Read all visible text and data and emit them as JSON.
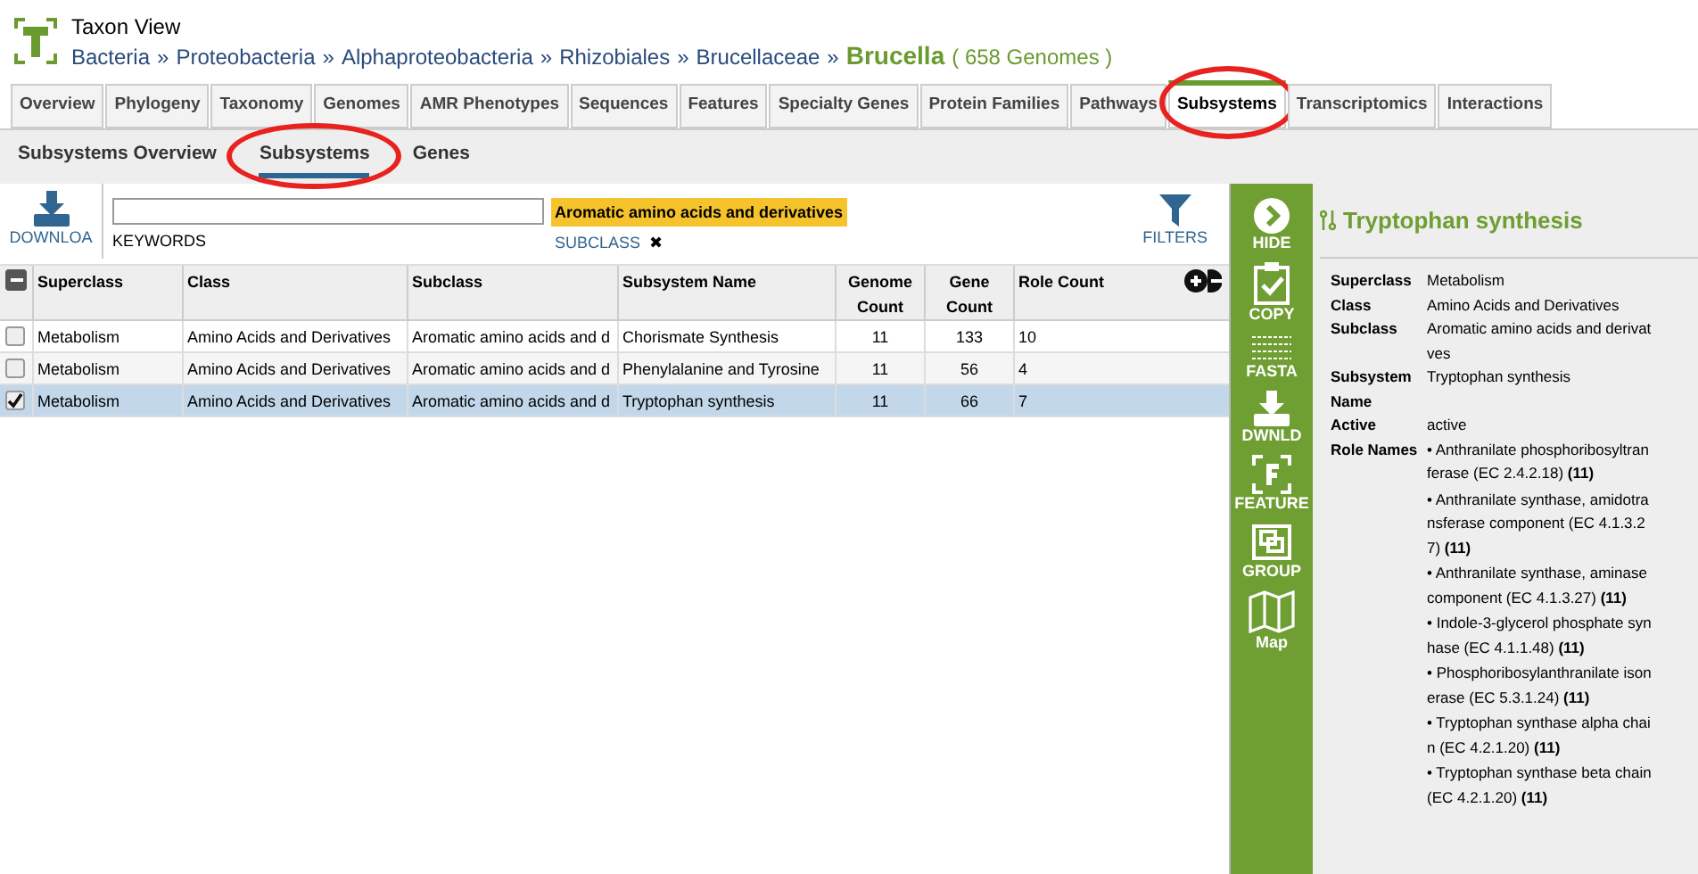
{
  "header": {
    "title": "Taxon View",
    "separator": "»",
    "breadcrumb": [
      "Bacteria",
      "Proteobacteria",
      "Alphaproteobacteria",
      "Rhizobiales",
      "Brucellaceae"
    ],
    "taxon": "Brucella",
    "genome_count": "( 658 Genomes )"
  },
  "tabs": [
    {
      "label": "Overview",
      "selected": false,
      "circled": false
    },
    {
      "label": "Phylogeny",
      "selected": false,
      "circled": false
    },
    {
      "label": "Taxonomy",
      "selected": false,
      "circled": false
    },
    {
      "label": "Genomes",
      "selected": false,
      "circled": false
    },
    {
      "label": "AMR Phenotypes",
      "selected": false,
      "circled": false
    },
    {
      "label": "Sequences",
      "selected": false,
      "circled": false
    },
    {
      "label": "Features",
      "selected": false,
      "circled": false
    },
    {
      "label": "Specialty Genes",
      "selected": false,
      "circled": false
    },
    {
      "label": "Protein Families",
      "selected": false,
      "circled": false
    },
    {
      "label": "Pathways",
      "selected": false,
      "circled": false
    },
    {
      "label": "Subsystems",
      "selected": true,
      "circled": true
    },
    {
      "label": "Transcriptomics",
      "selected": false,
      "circled": false
    },
    {
      "label": "Interactions",
      "selected": false,
      "circled": false
    }
  ],
  "subtabs": [
    {
      "label": "Subsystems Overview",
      "selected": false,
      "circled": false
    },
    {
      "label": "Subsystems",
      "selected": true,
      "circled": true
    },
    {
      "label": "Genes",
      "selected": false,
      "circled": false
    }
  ],
  "toolbar": {
    "download": "DOWNLOA",
    "keywords_label": "KEYWORDS",
    "filter_value": "Aromatic amino acids and derivatives",
    "filter_label": "SUBCLASS",
    "filter_remove": "✖",
    "filters": "FILTERS"
  },
  "table": {
    "select_all_partial": true,
    "columns": [
      "Superclass",
      "Class",
      "Subclass",
      "Subsystem Name",
      "Genome Count",
      "Gene Count",
      "Role Count"
    ],
    "rows": [
      {
        "selected": false,
        "cells": [
          "Metabolism",
          "Amino Acids and Derivatives",
          "Aromatic amino acids and d",
          "Chorismate Synthesis",
          "11",
          "133",
          "10"
        ]
      },
      {
        "selected": false,
        "cells": [
          "Metabolism",
          "Amino Acids and Derivatives",
          "Aromatic amino acids and d",
          "Phenylalanine and Tyrosine",
          "11",
          "56",
          "4"
        ]
      },
      {
        "selected": true,
        "cells": [
          "Metabolism",
          "Amino Acids and Derivatives",
          "Aromatic amino acids and d",
          "Tryptophan synthesis",
          "11",
          "66",
          "7"
        ]
      }
    ]
  },
  "actions": [
    {
      "kind": "hide",
      "label": "HIDE"
    },
    {
      "kind": "copy",
      "label": "COPY"
    },
    {
      "kind": "fasta",
      "label": "FASTA"
    },
    {
      "kind": "download",
      "label": "DWNLD"
    },
    {
      "kind": "feature",
      "label": "FEATURE"
    },
    {
      "kind": "group",
      "label": "GROUP"
    },
    {
      "kind": "map",
      "label": "Map"
    }
  ],
  "details": {
    "title": "Tryptophan synthesis",
    "fields": [
      {
        "label": "Superclass",
        "lines": [
          "Metabolism"
        ]
      },
      {
        "label": "Class",
        "lines": [
          "Amino Acids and Derivatives"
        ]
      },
      {
        "label": "Subclass",
        "lines": [
          "Aromatic amino acids and derivat",
          "ves"
        ]
      },
      {
        "label": "Subsystem Name",
        "lines": [
          "Tryptophan synthesis"
        ]
      },
      {
        "label": "Active",
        "lines": [
          "active"
        ]
      },
      {
        "label": "Role Names",
        "roles": [
          [
            "• Anthranilate phosphoribosyltran",
            "ferase (EC 2.4.2.18) **(11)**"
          ],
          [
            "• Anthranilate synthase, amidotra",
            "nsferase component (EC 4.1.3.2",
            "7) **(11)**"
          ],
          [
            "• Anthranilate synthase, aminase",
            "component (EC 4.1.3.27) **(11)**"
          ],
          [
            "• Indole-3-glycerol phosphate syn",
            "hase (EC 4.1.1.48) **(11)**"
          ],
          [
            "• Phosphoribosylanthranilate ison",
            "erase (EC 5.3.1.24) **(11)**"
          ],
          [
            "• Tryptophan synthase alpha chai",
            "n (EC 4.2.1.20) **(11)**"
          ],
          [
            "• Tryptophan synthase beta chain",
            "(EC 4.2.1.20) **(11)**"
          ]
        ]
      }
    ]
  }
}
